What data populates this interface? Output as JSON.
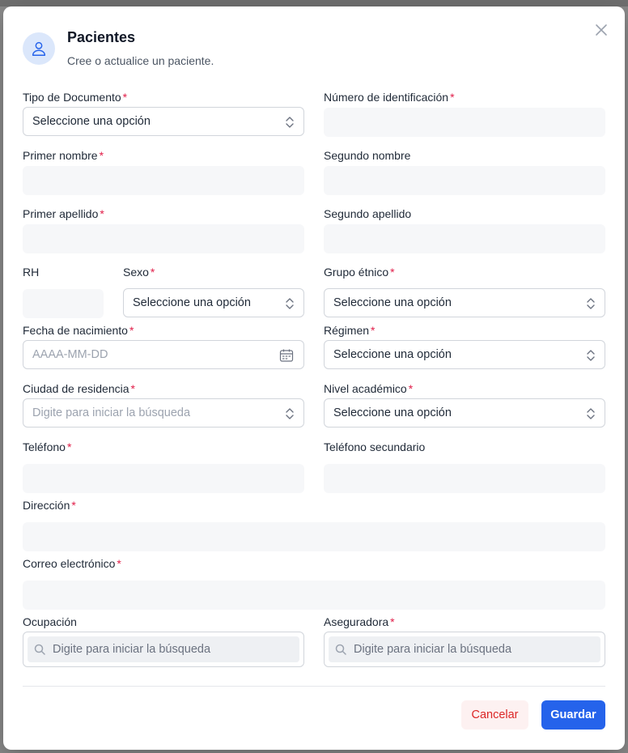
{
  "dialog": {
    "title": "Pacientes",
    "subtitle": "Cree o actualice un paciente."
  },
  "required_marker": "*",
  "fields": {
    "tipo_documento": {
      "label": "Tipo de Documento",
      "value": "Seleccione una opción"
    },
    "numero_identificacion": {
      "label": "Número de identificación",
      "value": ""
    },
    "primer_nombre": {
      "label": "Primer nombre",
      "value": ""
    },
    "segundo_nombre": {
      "label": "Segundo nombre",
      "value": ""
    },
    "primer_apellido": {
      "label": "Primer apellido",
      "value": ""
    },
    "segundo_apellido": {
      "label": "Segundo apellido",
      "value": ""
    },
    "rh": {
      "label": "RH",
      "value": ""
    },
    "sexo": {
      "label": "Sexo",
      "value": "Seleccione una opción"
    },
    "grupo_etnico": {
      "label": "Grupo étnico",
      "value": "Seleccione una opción"
    },
    "fecha_nacimiento": {
      "label": "Fecha de nacimiento",
      "placeholder": "AAAA-MM-DD"
    },
    "regimen": {
      "label": "Régimen",
      "value": "Seleccione una opción"
    },
    "ciudad_residencia": {
      "label": "Ciudad de residencia",
      "placeholder": "Digite para iniciar la búsqueda"
    },
    "nivel_academico": {
      "label": "Nivel académico",
      "value": "Seleccione una opción"
    },
    "telefono": {
      "label": "Teléfono",
      "value": ""
    },
    "telefono_secundario": {
      "label": "Teléfono secundario",
      "value": ""
    },
    "direccion": {
      "label": "Dirección",
      "value": ""
    },
    "correo": {
      "label": "Correo electrónico",
      "value": ""
    },
    "ocupacion": {
      "label": "Ocupación",
      "placeholder": "Digite para iniciar la búsqueda"
    },
    "aseguradora": {
      "label": "Aseguradora",
      "placeholder": "Digite para iniciar la búsqueda"
    }
  },
  "buttons": {
    "cancel": "Cancelar",
    "save": "Guardar"
  },
  "icons": {
    "header": "user-icon",
    "close": "close-icon",
    "select": "chevron-up-down-icon",
    "date": "calendar-icon",
    "search": "search-icon"
  },
  "colors": {
    "accent": "#2563eb",
    "required": "#e11d48",
    "cancel_text": "#dc2626",
    "icon_bg": "#dbe7fb"
  }
}
